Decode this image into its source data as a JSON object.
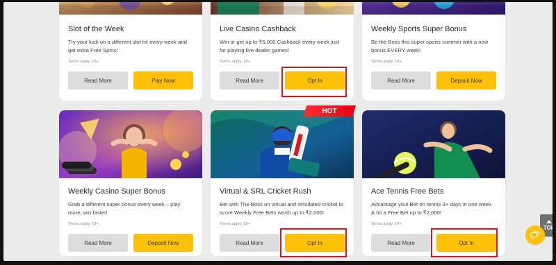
{
  "promotions": [
    {
      "title": "Slot of the Week",
      "description": "Try your luck on a different slot hit every week and get extra Free Spins!",
      "terms": "Terms apply, 18+",
      "secondary_label": "Read More",
      "primary_label": "Play Now"
    },
    {
      "title": "Live Casino Cashback",
      "description": "Win or get up to ₹5,000 Cashback every week just for playing live dealer games!",
      "terms": "Terms apply, 18+",
      "secondary_label": "Read More",
      "primary_label": "Opt In"
    },
    {
      "title": "Weekly Sports Super Bonus",
      "description": "Be the Boss this super sports summer with a new bonus EVERY week!",
      "terms": "Terms apply, 18+",
      "secondary_label": "Read More",
      "primary_label": "Deposit Now"
    },
    {
      "title": "Weekly Casino Super Bonus",
      "description": "Grab a different super bonus every week – play more, win faster!",
      "terms": "Terms apply, 18+",
      "secondary_label": "Read More",
      "primary_label": "Deposit Now"
    },
    {
      "title": "Virtual & SRL Cricket Rush",
      "description": "Bet with The Boss on virtual and simulated cricket to score Weekly Free Bets worth up to ₹2,000!",
      "terms": "Terms apply, 18+",
      "secondary_label": "Read More",
      "primary_label": "Opt In",
      "badge": "HOT"
    },
    {
      "title": "Ace Tennis Free Bets",
      "description": "Advantage you! Bet on tennis 3+ days in one week & hit a Free Bet up to ₹2,000!",
      "terms": "Terms apply, 18+",
      "secondary_label": "Read More",
      "primary_label": "Opt In"
    }
  ],
  "widgets": {
    "top_label": "TOP",
    "chat_icon": "chat-bubbles-icon",
    "up_icon": "arrow-up-icon"
  },
  "colors": {
    "accent": "#ffc107",
    "secondary_button": "#dddddd",
    "highlight": "#e2141b",
    "background": "#ececec"
  }
}
